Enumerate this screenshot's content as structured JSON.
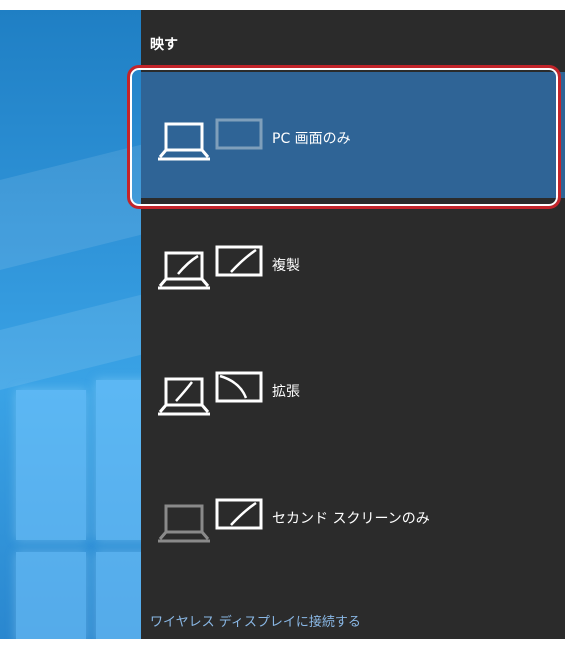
{
  "panel": {
    "title": "映す"
  },
  "options": [
    {
      "label": "PC 画面のみ",
      "selected": true,
      "icon": "pc-screen-only-icon"
    },
    {
      "label": "複製",
      "selected": false,
      "icon": "duplicate-icon"
    },
    {
      "label": "拡張",
      "selected": false,
      "icon": "extend-icon"
    },
    {
      "label": "セカンド スクリーンのみ",
      "selected": false,
      "icon": "second-screen-only-icon"
    }
  ],
  "wireless_link": "ワイヤレス ディスプレイに接続する",
  "colors": {
    "panel_bg": "#2b2b2b",
    "selected_bg": "#2f6496",
    "link": "#8ab8e6",
    "highlight_ring": "#c3242a"
  }
}
